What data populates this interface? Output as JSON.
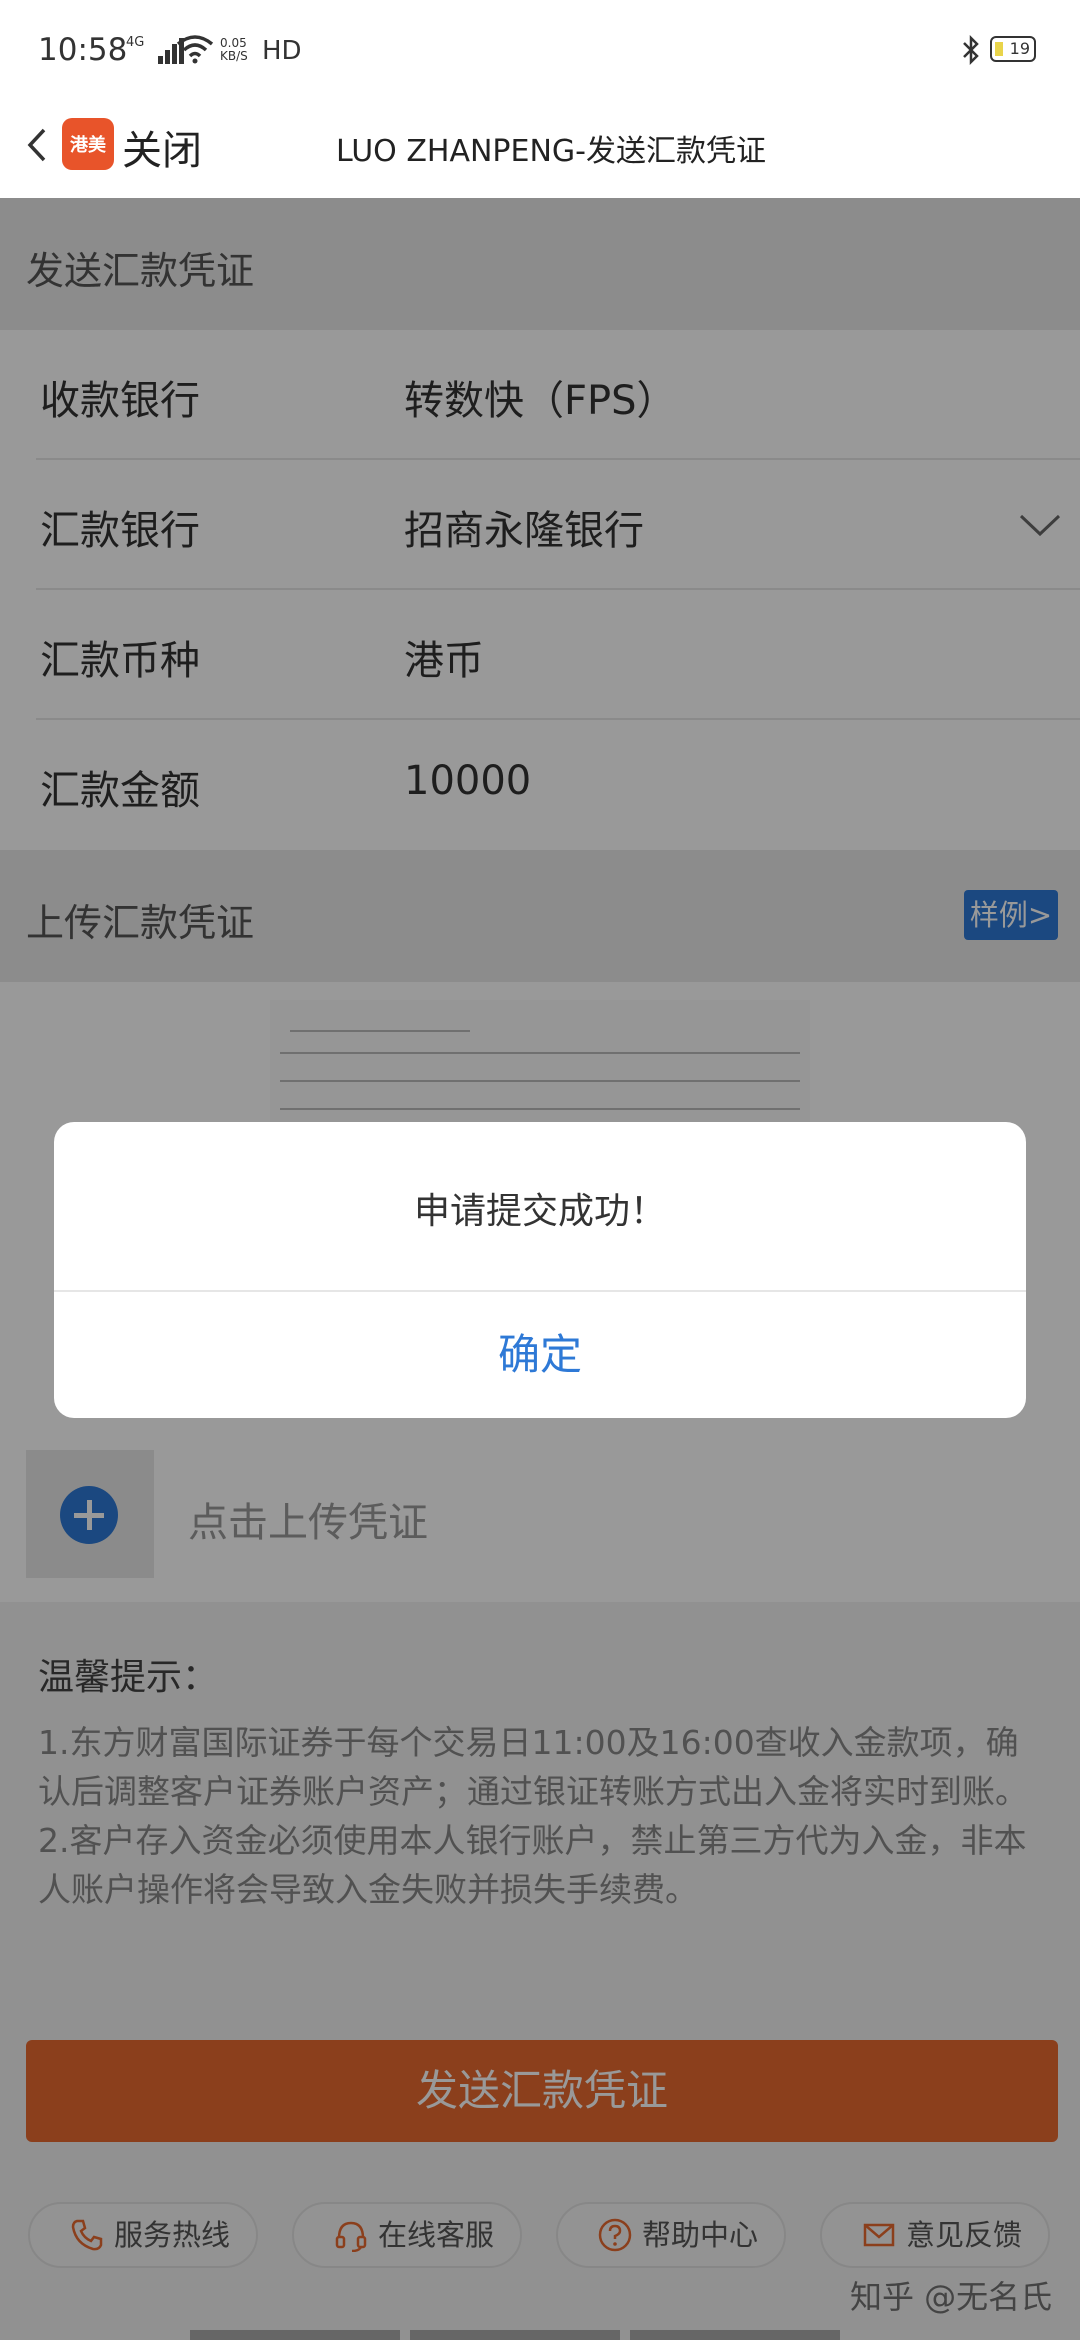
{
  "status_bar": {
    "time": "10:58",
    "network": "4G",
    "speed_value": "0.05",
    "speed_unit": "KB/S",
    "hd": "HD",
    "battery": "19"
  },
  "nav": {
    "logo_text": "港美",
    "close_label": "关闭",
    "title": "LUO ZHANPENG-发送汇款凭证"
  },
  "section_send": {
    "title": "发送汇款凭证"
  },
  "form": {
    "rows": [
      {
        "label": "收款银行",
        "value": "转数快（FPS）"
      },
      {
        "label": "汇款银行",
        "value": "招商永隆银行"
      },
      {
        "label": "汇款币种",
        "value": "港币"
      },
      {
        "label": "汇款金额",
        "value": "10000"
      }
    ]
  },
  "section_upload": {
    "title": "上传汇款凭证",
    "sample_label": "样例>"
  },
  "upload": {
    "add_label": "点击上传凭证"
  },
  "tips": {
    "title": "温馨提示：",
    "items": [
      "1.东方财富国际证券于每个交易日11:00及16:00查收入金款项，确认后调整客户证券账户资产；通过银证转账方式出入金将实时到账。",
      "2.客户存入资金必须使用本人银行账户，禁止第三方代为入金，非本人账户操作将会导致入金失败并损失手续费。"
    ]
  },
  "submit": {
    "label": "发送汇款凭证"
  },
  "footer": {
    "items": [
      {
        "label": "服务热线",
        "icon": "phone-icon"
      },
      {
        "label": "在线客服",
        "icon": "headset-icon"
      },
      {
        "label": "帮助中心",
        "icon": "help-icon"
      },
      {
        "label": "意见反馈",
        "icon": "mail-icon"
      }
    ]
  },
  "watermark": "知乎 @无名氏",
  "dialog": {
    "message": "申请提交成功！",
    "confirm_label": "确定"
  },
  "colors": {
    "accent_blue": "#2e79d6",
    "submit_orange": "#e86a2f",
    "logo_red": "#e8542a"
  }
}
